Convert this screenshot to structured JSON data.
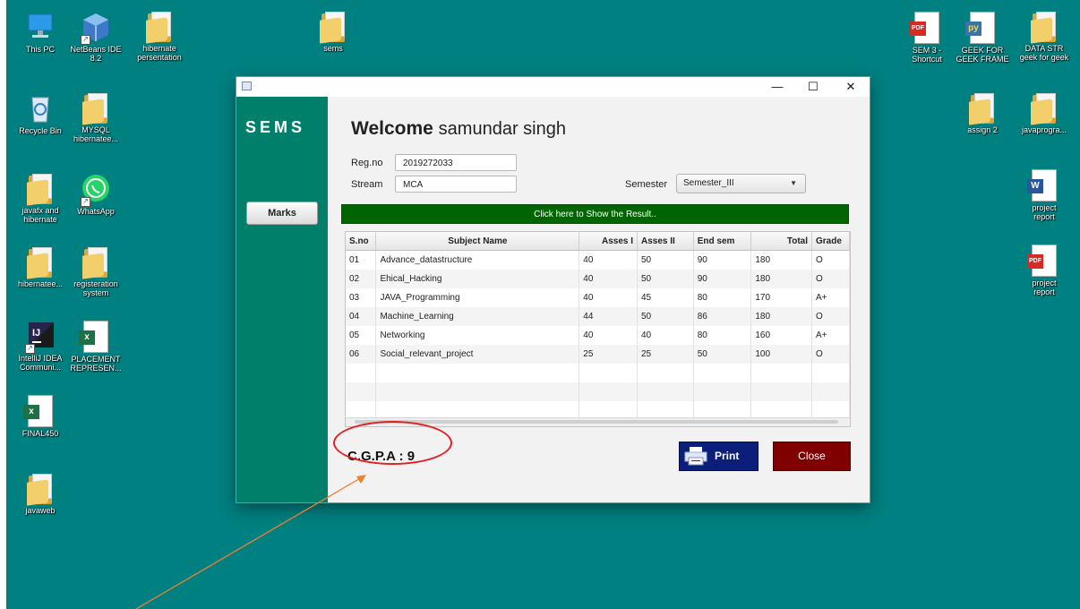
{
  "desktop": {
    "icons_left": [
      {
        "label": "This PC",
        "icon": "computer-icon"
      },
      {
        "label": "NetBeans IDE\n8.2",
        "icon": "netbeans-icon"
      },
      {
        "label": "hibernate\npersentation",
        "icon": "folder-icon"
      },
      {
        "label": "Recycle Bin",
        "icon": "recycle-bin-icon"
      },
      {
        "label": "MYSQL\nhibernatee...",
        "icon": "folder-icon"
      },
      {
        "label": "javafx and\nhibernate",
        "icon": "folder-icon"
      },
      {
        "label": "WhatsApp",
        "icon": "whatsapp-icon"
      },
      {
        "label": "hibernatee...",
        "icon": "folder-icon"
      },
      {
        "label": "registeration\nsystem",
        "icon": "folder-icon"
      },
      {
        "label": "IntelliJ IDEA\nCommuni...",
        "icon": "intellij-icon"
      },
      {
        "label": "PLACEMENT\nREPRESEN...",
        "icon": "excel-icon"
      },
      {
        "label": "FINAL450",
        "icon": "excel-icon"
      },
      {
        "label": "javaweb",
        "icon": "folder-icon"
      }
    ],
    "icons_top": [
      {
        "label": "sems",
        "icon": "folder-icon"
      }
    ],
    "icons_right": [
      {
        "label": "SEM 3 -\nShortcut",
        "icon": "pdf-icon"
      },
      {
        "label": "GEEK FOR\nGEEK FRAME",
        "icon": "python-icon"
      },
      {
        "label": "DATA STR\ngeek for geek",
        "icon": "folder-icon"
      },
      {
        "label": "assign 2",
        "icon": "folder-icon"
      },
      {
        "label": "javaprogra...",
        "icon": "folder-icon"
      },
      {
        "label": "project\nreport",
        "icon": "word-icon"
      },
      {
        "label": "project\nreport",
        "icon": "pdf-icon"
      }
    ]
  },
  "window": {
    "controls": {
      "minimize": "—",
      "maximize": "☐",
      "close": "✕"
    },
    "sidebar": {
      "brand": "SEMS",
      "marks_button": "Marks"
    },
    "welcome": {
      "prefix": "Welcome",
      "name": "samundar singh"
    },
    "form": {
      "regno_label": "Reg.no",
      "regno_value": "2019272033",
      "stream_label": "Stream",
      "stream_value": "MCA",
      "semester_label": "Semester",
      "semester_value": "Semester_III"
    },
    "result_bar": "Click here to Show the Result..",
    "table": {
      "headers": [
        "S.no",
        "Subject Name",
        "Asses I",
        "Asses II",
        "End sem",
        "Total",
        "Grade"
      ],
      "rows": [
        [
          "01",
          "Advance_datastructure",
          "40",
          "50",
          "90",
          "180",
          "O"
        ],
        [
          "02",
          "Ehical_Hacking",
          "40",
          "50",
          "90",
          "180",
          "O"
        ],
        [
          "03",
          "JAVA_Programming",
          "40",
          "45",
          "80",
          "170",
          "A+"
        ],
        [
          "04",
          "Machine_Learning",
          "44",
          "50",
          "86",
          "180",
          "O"
        ],
        [
          "05",
          "Networking",
          "40",
          "40",
          "80",
          "160",
          "A+"
        ],
        [
          "06",
          "Social_relevant_project",
          "25",
          "25",
          "50",
          "100",
          "O"
        ]
      ],
      "empty_rows": 3
    },
    "cgpa_label": "C.G.P.A :",
    "cgpa_value": "9",
    "print_button": "Print",
    "close_button": "Close"
  },
  "colors": {
    "desktop": "#008080",
    "sidebar": "#00806b",
    "result_bar": "#006400",
    "print_button": "#0b1f7a",
    "close_button": "#800000",
    "annotation_circle": "#e51f1f",
    "annotation_arrow": "#f08030"
  }
}
